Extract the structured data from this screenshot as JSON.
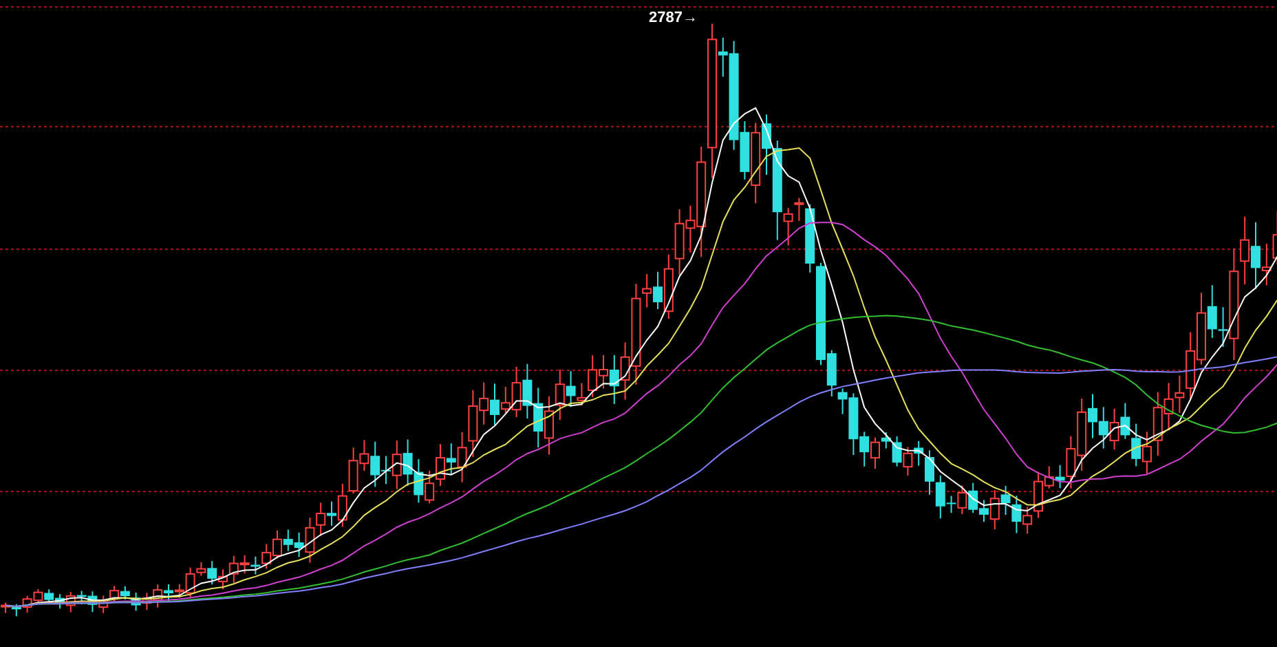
{
  "chart": {
    "peak_label": "2787→"
  }
}
